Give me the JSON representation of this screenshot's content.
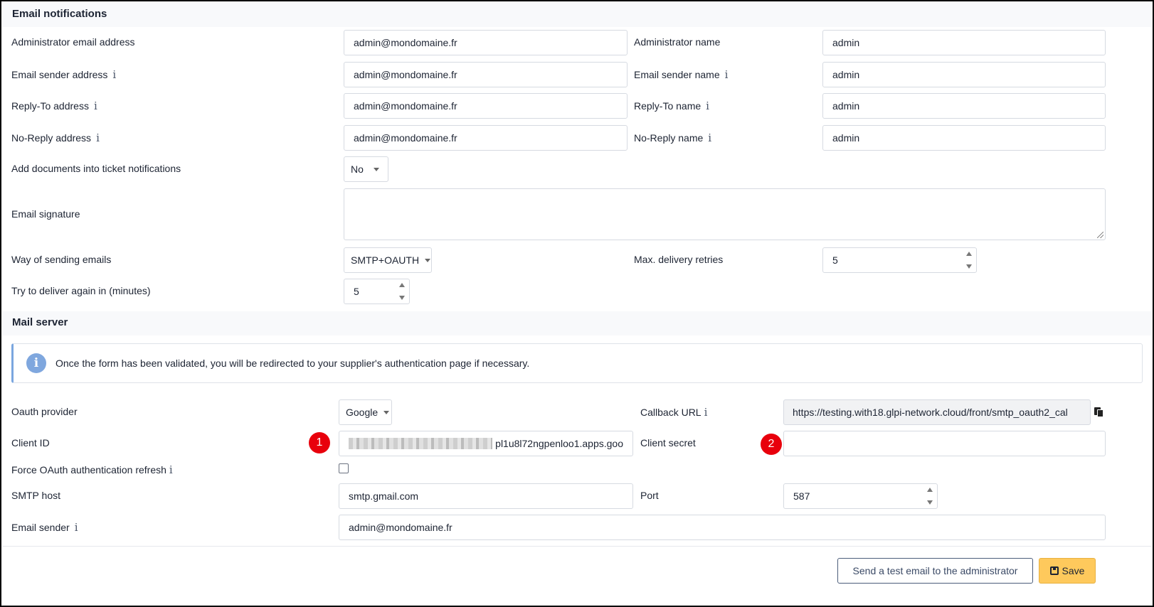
{
  "email_notifications": {
    "title": "Email notifications",
    "admin_email_label": "Administrator email address",
    "admin_email_value": "admin@mondomaine.fr",
    "admin_name_label": "Administrator name",
    "admin_name_value": "admin",
    "sender_address_label": "Email sender address",
    "sender_address_value": "admin@mondomaine.fr",
    "sender_name_label": "Email sender name",
    "sender_name_value": "admin",
    "reply_to_address_label": "Reply-To address",
    "reply_to_address_value": "admin@mondomaine.fr",
    "reply_to_name_label": "Reply-To name",
    "reply_to_name_value": "admin",
    "no_reply_address_label": "No-Reply address",
    "no_reply_address_value": "admin@mondomaine.fr",
    "no_reply_name_label": "No-Reply name",
    "no_reply_name_value": "admin",
    "add_documents_label": "Add documents into ticket notifications",
    "add_documents_value": "No",
    "signature_label": "Email signature",
    "signature_value": "",
    "sending_way_label": "Way of sending emails",
    "sending_way_value": "SMTP+OAUTH",
    "max_retries_label": "Max. delivery retries",
    "max_retries_value": "5",
    "retry_delay_label": "Try to deliver again in (minutes)",
    "retry_delay_value": "5"
  },
  "mail_server": {
    "title": "Mail server",
    "alert_text": "Once the form has been validated, you will be redirected to your supplier's authentication page if necessary.",
    "oauth_provider_label": "Oauth provider",
    "oauth_provider_value": "Google",
    "callback_url_label": "Callback URL",
    "callback_url_value": "https://testing.with18.glpi-network.cloud/front/smtp_oauth2_cal",
    "client_id_label": "Client ID",
    "client_id_visible_value": "pl1u8l72ngpenloo1.apps.goo",
    "client_secret_label": "Client secret",
    "client_secret_value": "",
    "force_refresh_label": "Force OAuth authentication refresh",
    "force_refresh_checked": false,
    "smtp_host_label": "SMTP host",
    "smtp_host_value": "smtp.gmail.com",
    "port_label": "Port",
    "port_value": "587",
    "email_sender_label": "Email sender",
    "email_sender_value": "admin@mondomaine.fr"
  },
  "badges": {
    "one": "1",
    "two": "2"
  },
  "footer": {
    "test_email_button": "Send a test email to the administrator",
    "save_button": "Save"
  },
  "icons": {
    "info": "info-icon",
    "alert": "info-circle-icon",
    "copy": "copy-icon",
    "save": "save-icon"
  },
  "colors": {
    "save_button": "#fec95c",
    "badge": "#e8000c",
    "alert_accent": "#7aa6df"
  }
}
